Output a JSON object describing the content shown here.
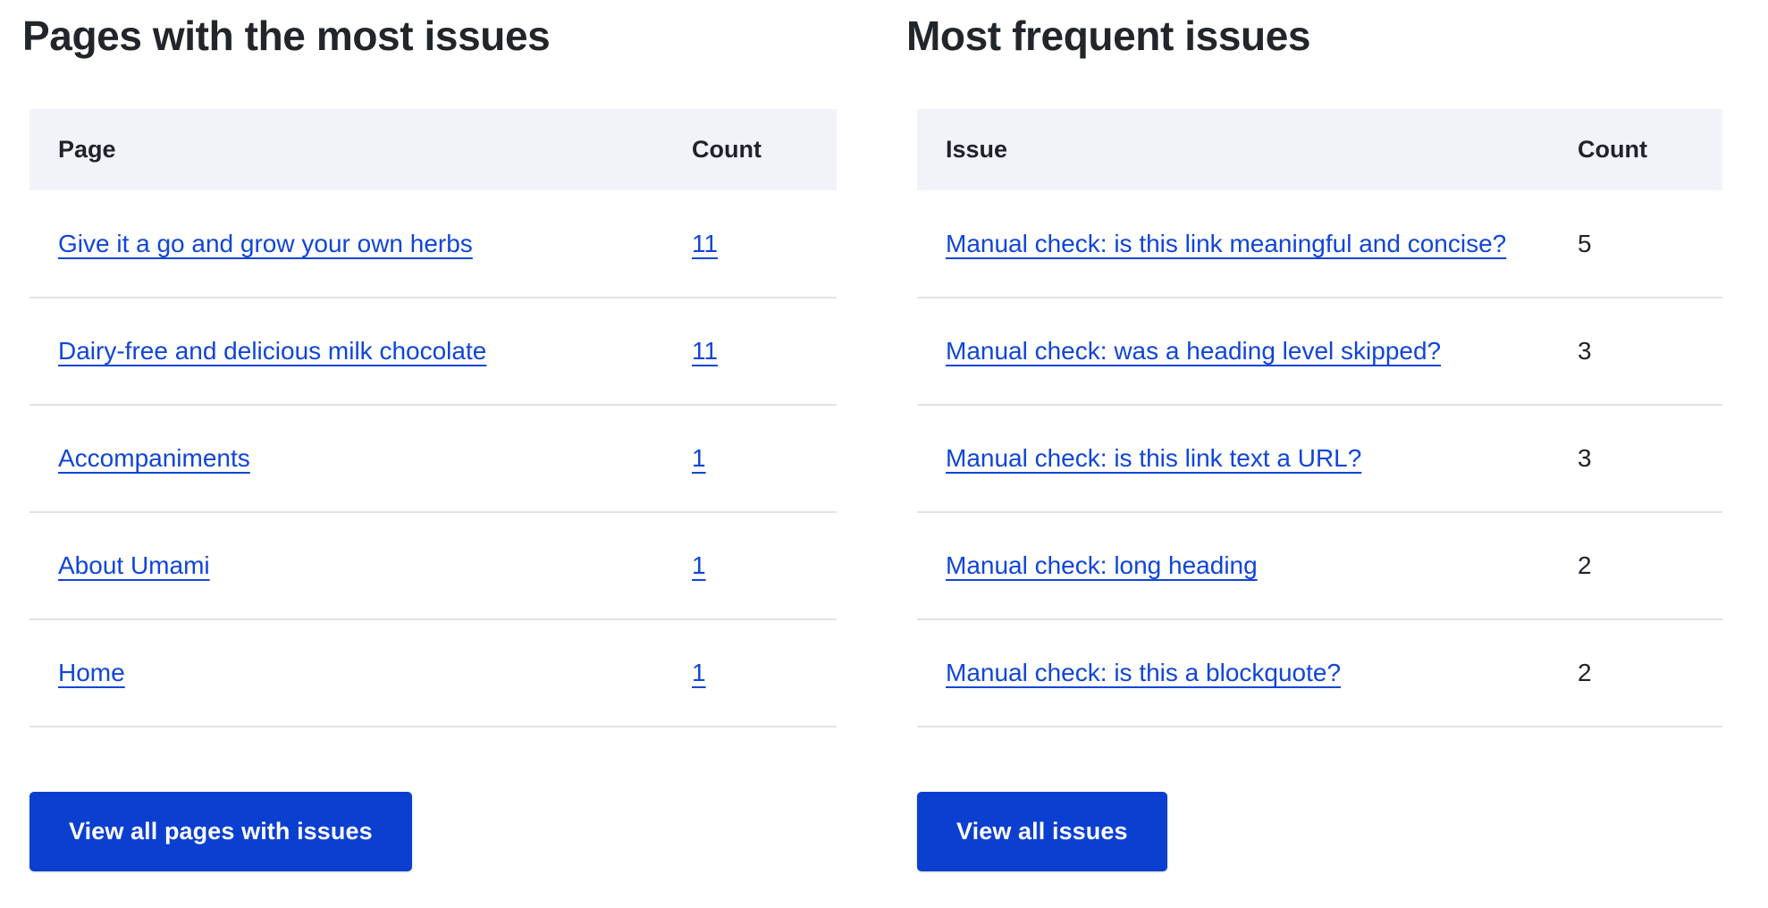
{
  "colors": {
    "link": "#1045d8",
    "button_bg": "#0b3fd0",
    "header_bg": "#f2f3f8",
    "text": "#1f2228",
    "divider": "#e2e3e7"
  },
  "panels": [
    {
      "title": "Pages with the most issues",
      "columns": {
        "name": "Page",
        "count": "Count"
      },
      "count_is_link": true,
      "rows": [
        {
          "name": "Give it a go and grow your own herbs",
          "count": "11"
        },
        {
          "name": "Dairy-free and delicious milk chocolate",
          "count": "11"
        },
        {
          "name": "Accompaniments",
          "count": "1"
        },
        {
          "name": "About Umami",
          "count": "1"
        },
        {
          "name": "Home",
          "count": "1"
        }
      ],
      "button_label": "View all pages with issues"
    },
    {
      "title": "Most frequent issues",
      "columns": {
        "name": "Issue",
        "count": "Count"
      },
      "count_is_link": false,
      "rows": [
        {
          "name": "Manual check: is this link meaningful and concise?",
          "count": "5"
        },
        {
          "name": "Manual check: was a heading level skipped?",
          "count": "3"
        },
        {
          "name": "Manual check: is this link text a URL?",
          "count": "3"
        },
        {
          "name": "Manual check: long heading",
          "count": "2"
        },
        {
          "name": "Manual check: is this a blockquote?",
          "count": "2"
        }
      ],
      "button_label": "View all issues"
    }
  ]
}
